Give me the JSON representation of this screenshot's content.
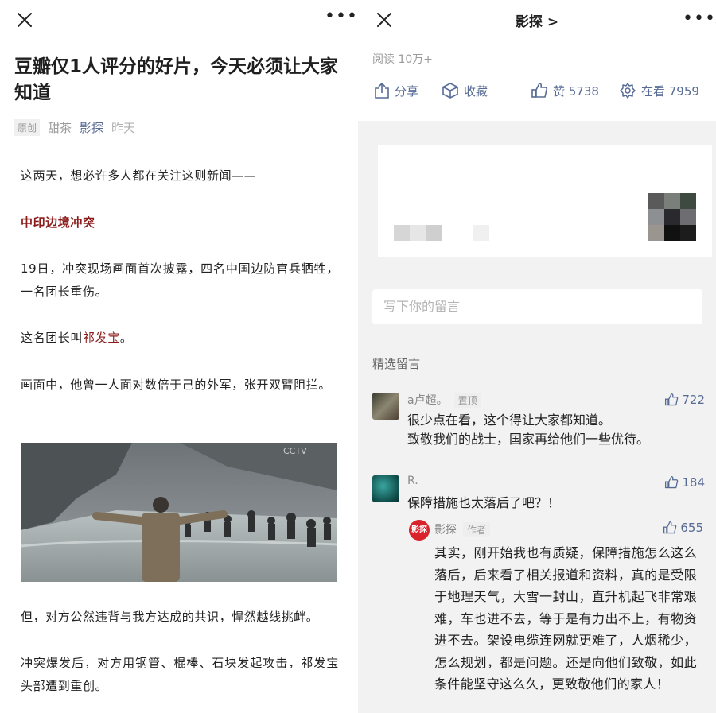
{
  "left": {
    "title": "豆瓣仅1人评分的好片，今天必须让大家知道",
    "meta": {
      "original_tag": "原创",
      "author": "甜茶",
      "account": "影探",
      "time": "昨天"
    },
    "paragraphs": {
      "p1": "这两天，想必许多人都在关注这则新闻——",
      "p2": "中印边境冲突",
      "p3": "19日，冲突现场画面首次披露，四名中国边防官兵牺牲，一名团长重伤。",
      "p4_pre": "这名团长叫",
      "p4_name": "祁发宝",
      "p4_post": "。",
      "p5": "画面中，他曾一人面对数倍于己的外军，张开双臂阻拦。",
      "p6": "但，对方公然违背与我方达成的共识，悍然越线挑衅。",
      "p7": "冲突爆发后，对方用钢管、棍棒、石块发起攻击，祁发宝头部遭到重创。"
    },
    "photo_watermark": "CCTV"
  },
  "right": {
    "account_title": "影探 >",
    "read_count": "阅读 10万+",
    "actions": {
      "share": "分享",
      "favorite": "收藏",
      "like": "赞 5738",
      "watching": "在看 7959"
    },
    "comment_placeholder": "写下你的留言",
    "selected_title": "精选留言",
    "comments": [
      {
        "name": "a卢超。",
        "pin": "置顶",
        "likes": "722",
        "line1": "很少点在看，这个得让大家都知道。",
        "line2": "致敬我们的战士，国家再给他们一些优待。"
      },
      {
        "name": "R.",
        "likes": "184",
        "line1": "保障措施也太落后了吧？！"
      }
    ],
    "reply": {
      "avatar_text": "影探",
      "name": "影探",
      "role": "作者",
      "likes": "655",
      "text": "其实，刚开始我也有质疑，保障措施怎么这么落后，后来看了相关报道和资料，真的是受限于地理天气，大雪一封山，直升机起飞非常艰难，车也进不去，等于是有力出不上，有物资进不去。架设电缆连网就更难了，人烟稀少，怎么规划，都是问题。还是向他们致敬，如此条件能坚守这么久，更致敬他们的家人！"
    }
  },
  "colors": {
    "link_blue": "#576b95",
    "highlight_red": "#8b1c1c",
    "pane_gray": "#f2f2f2"
  },
  "icons": [
    "close-icon",
    "more-icon",
    "share-icon",
    "favorite-icon",
    "thumb-up-icon",
    "watching-icon"
  ]
}
